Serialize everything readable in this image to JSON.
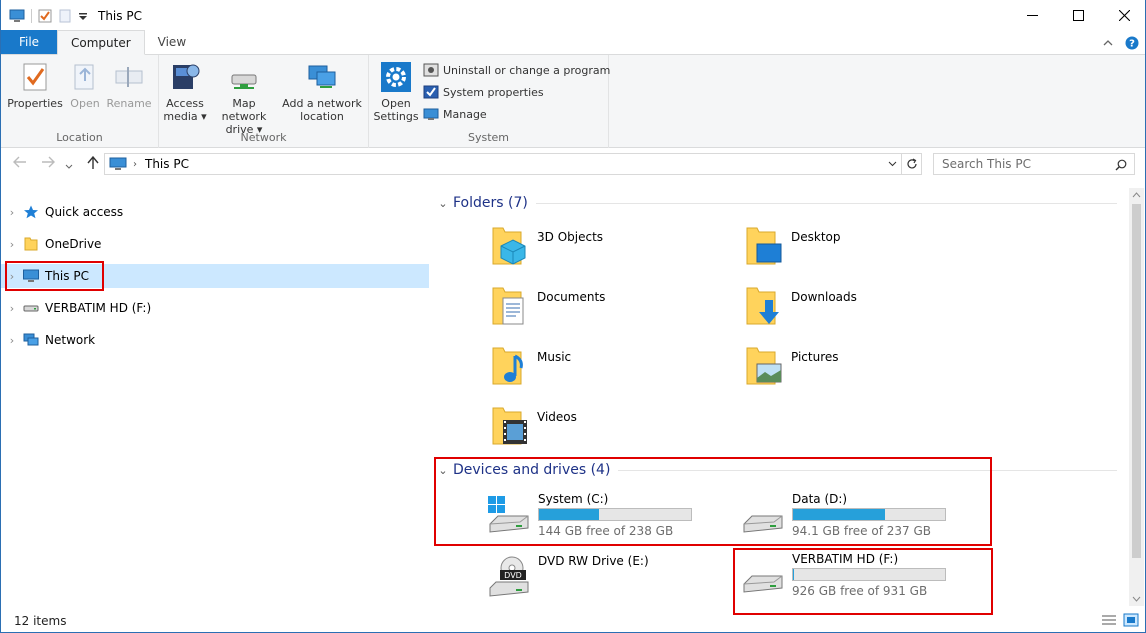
{
  "window": {
    "title": "This PC",
    "minimize": "—",
    "maximize": "☐",
    "close": "✕"
  },
  "tabs": [
    {
      "label": "File"
    },
    {
      "label": "Computer"
    },
    {
      "label": "View"
    }
  ],
  "ribbon": {
    "location": {
      "label": "Location",
      "properties": "Properties",
      "open": "Open",
      "rename": "Rename"
    },
    "network": {
      "label": "Network",
      "access_media_1": "Access",
      "access_media_2": "media ▾",
      "map_drive_1": "Map network",
      "map_drive_2": "drive ▾",
      "add_location_1": "Add a network",
      "add_location_2": "location"
    },
    "system": {
      "label": "System",
      "open_settings_1": "Open",
      "open_settings_2": "Settings",
      "uninstall": "Uninstall or change a program",
      "system_properties": "System properties",
      "manage": "Manage"
    }
  },
  "address": {
    "path": "This PC",
    "search_placeholder": "Search This PC"
  },
  "nav": {
    "items": [
      {
        "label": "Quick access"
      },
      {
        "label": "OneDrive"
      },
      {
        "label": "This PC"
      },
      {
        "label": "VERBATIM HD (F:)"
      },
      {
        "label": "Network"
      }
    ]
  },
  "folders": {
    "heading": "Folders (7)",
    "items": [
      {
        "name": "3D Objects"
      },
      {
        "name": "Desktop"
      },
      {
        "name": "Documents"
      },
      {
        "name": "Downloads"
      },
      {
        "name": "Music"
      },
      {
        "name": "Pictures"
      },
      {
        "name": "Videos"
      }
    ]
  },
  "devices": {
    "heading": "Devices and drives (4)",
    "items": [
      {
        "name": "System (C:)",
        "free": "144 GB free of 238 GB",
        "used_fraction": 0.395
      },
      {
        "name": "Data (D:)",
        "free": "94.1 GB free of 237 GB",
        "used_fraction": 0.603
      },
      {
        "name": "DVD RW Drive (E:)",
        "dvd_label": "DVD"
      },
      {
        "name": "VERBATIM HD (F:)",
        "free": "926 GB free of 931 GB",
        "used_fraction": 0.005
      }
    ]
  },
  "status": {
    "items": "12 items"
  },
  "colors": {
    "accent": "#1979ca",
    "selection": "#cce8ff",
    "drive_bar": "#26a0da",
    "highlight": "#e00000",
    "section_heading": "#1e3287"
  }
}
